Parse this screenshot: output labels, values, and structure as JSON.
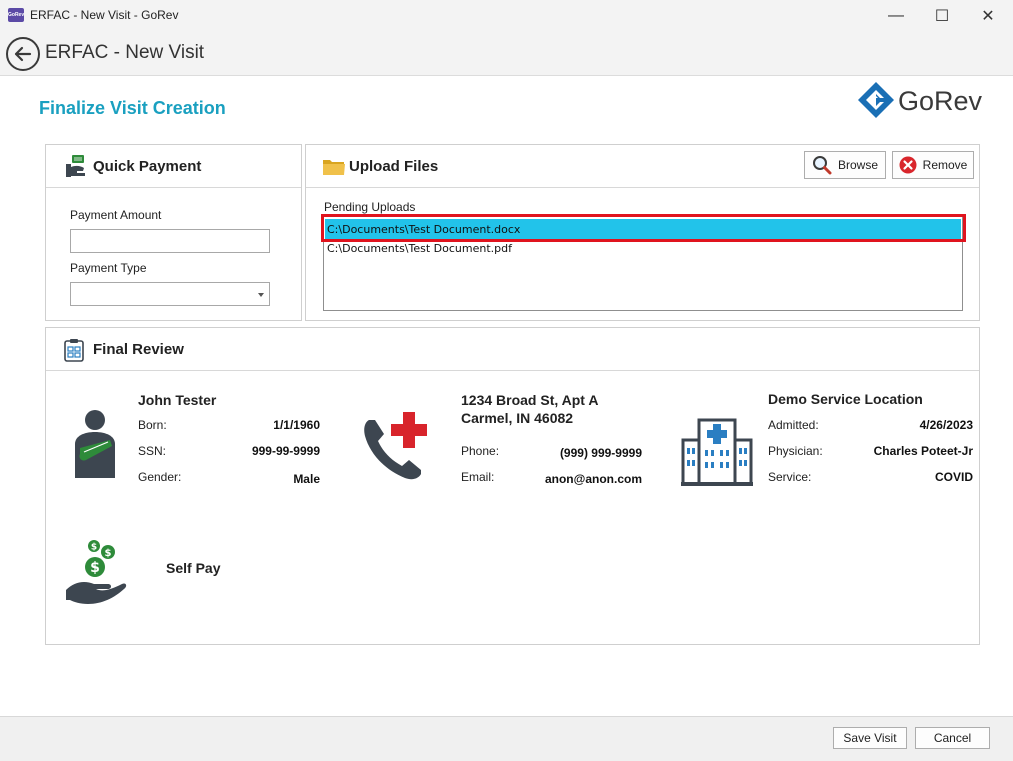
{
  "window": {
    "title": "ERFAC - New Visit - GoRev",
    "app_icon_text": "GoRev",
    "minimize_glyph": "—",
    "maximize_glyph": "☐",
    "close_glyph": "✕"
  },
  "nav": {
    "title": "ERFAC - New Visit"
  },
  "brand": {
    "logo_text": "GoRev",
    "color": "#1a6fb5"
  },
  "page": {
    "heading": "Finalize Visit Creation",
    "heading_color": "#1aa0c0"
  },
  "quick_payment": {
    "title": "Quick Payment",
    "amount_label": "Payment Amount",
    "amount_value": "",
    "type_label": "Payment Type",
    "type_value": ""
  },
  "upload": {
    "title": "Upload Files",
    "browse_label": "Browse",
    "remove_label": "Remove",
    "pending_label": "Pending Uploads",
    "files": [
      {
        "path": "C:\\Documents\\Test Document.docx",
        "selected": true
      },
      {
        "path": "C:\\Documents\\Test Document.pdf",
        "selected": false
      }
    ],
    "selected_color": "#22c3ea",
    "highlight_border_color": "#e0141e"
  },
  "final_review": {
    "title": "Final Review",
    "patient": {
      "name": "John Tester",
      "rows": [
        {
          "label": "Born:",
          "value": "1/1/1960"
        },
        {
          "label": "SSN:",
          "value": "999-99-9999"
        },
        {
          "label": "Gender:",
          "value": "Male"
        }
      ]
    },
    "contact": {
      "address_line1": "1234 Broad St, Apt A",
      "address_line2": "Carmel, IN 46082",
      "rows": [
        {
          "label": "Phone:",
          "value": "(999) 999-9999"
        },
        {
          "label": "Email:",
          "value": "anon@anon.com"
        }
      ]
    },
    "location": {
      "name": "Demo Service Location",
      "rows": [
        {
          "label": "Admitted:",
          "value": "4/26/2023"
        },
        {
          "label": "Physician:",
          "value": "Charles Poteet-Jr"
        },
        {
          "label": "Service:",
          "value": "COVID"
        }
      ]
    },
    "payer": {
      "label": "Self Pay"
    }
  },
  "footer": {
    "save_label": "Save Visit",
    "cancel_label": "Cancel"
  },
  "colors": {
    "icon_dark": "#3d4650",
    "medical_red": "#d8242b",
    "money_green": "#2e8b3a",
    "hospital_blue": "#2a7ec2"
  }
}
